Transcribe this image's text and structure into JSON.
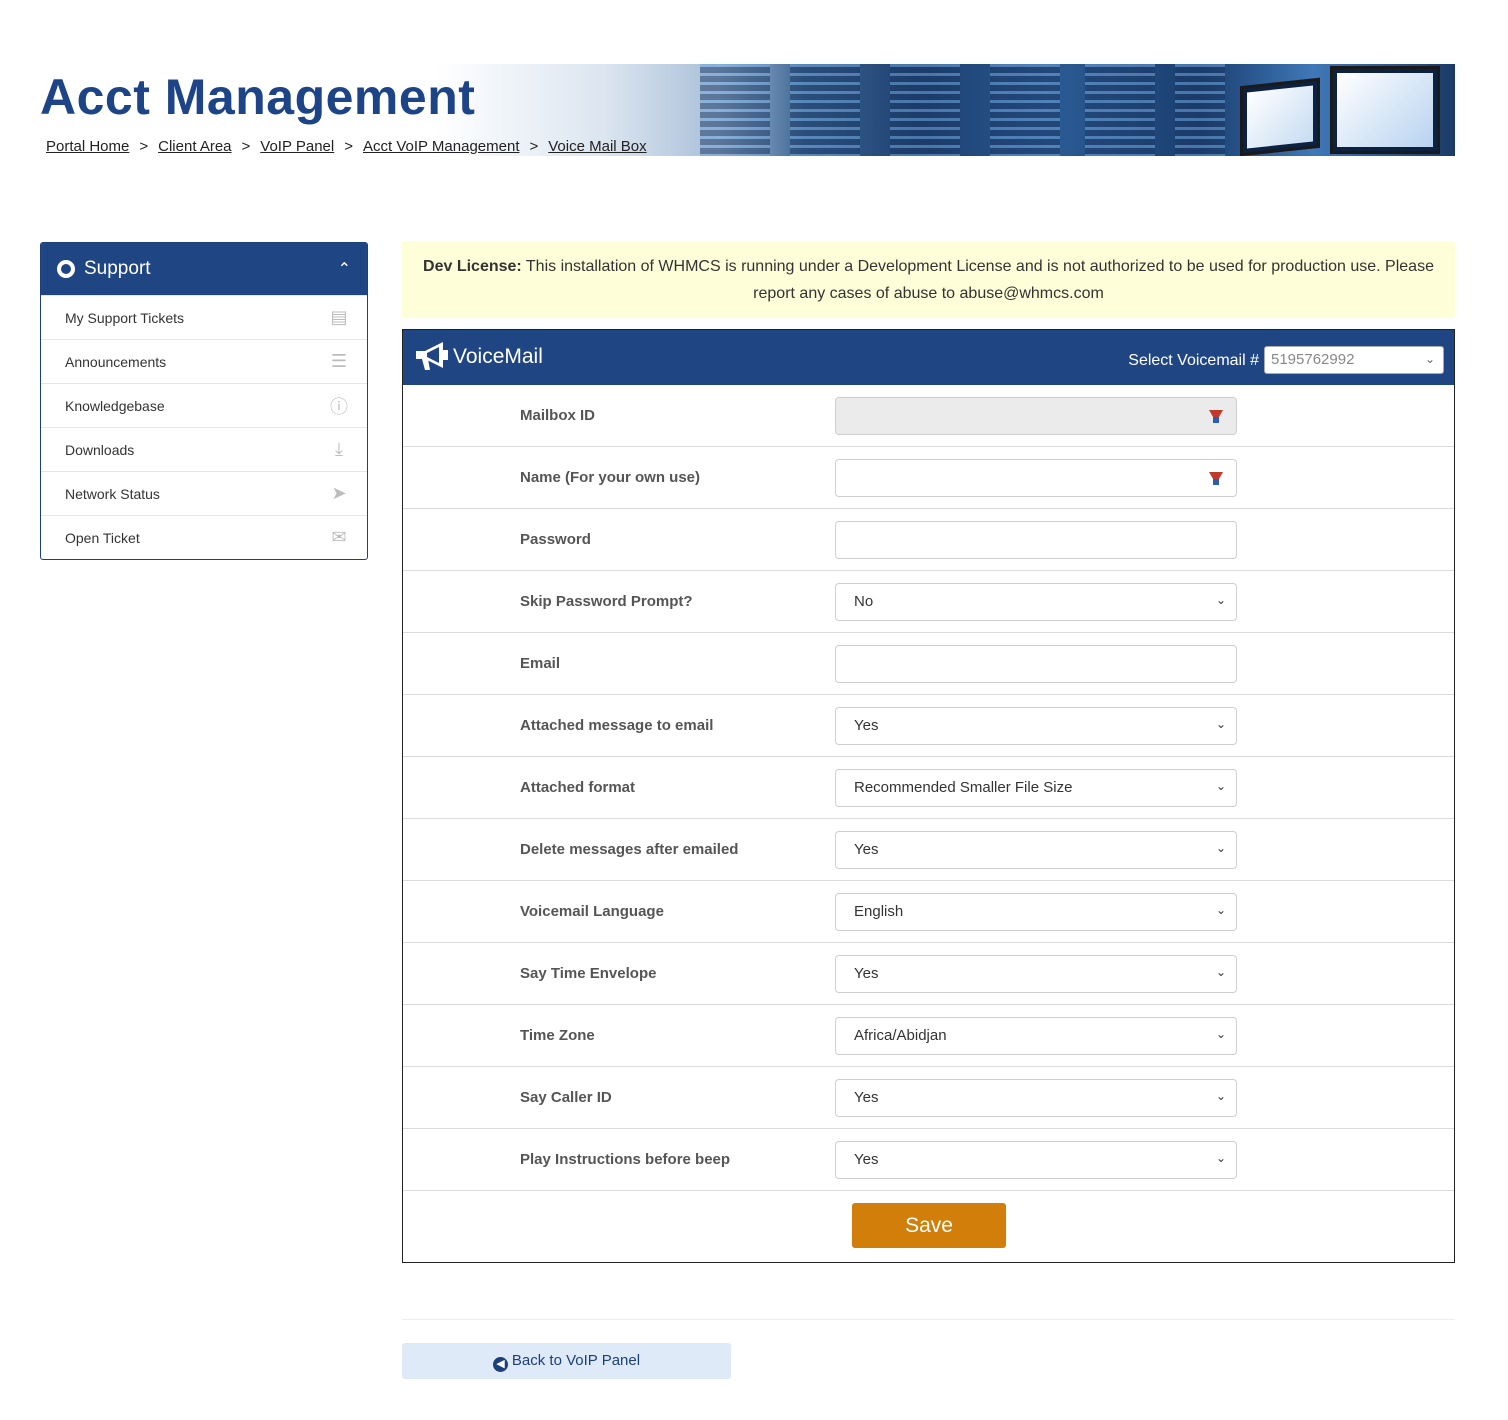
{
  "header": {
    "title": "Acct Management",
    "breadcrumb": [
      "Portal Home",
      "Client Area",
      "VoIP Panel",
      "Acct VoIP Management",
      "Voice Mail Box"
    ],
    "separator": ">"
  },
  "sidebar": {
    "title": "Support",
    "items": [
      {
        "label": "My Support Tickets",
        "icon": "ticket-icon"
      },
      {
        "label": "Announcements",
        "icon": "list-icon"
      },
      {
        "label": "Knowledgebase",
        "icon": "info-icon"
      },
      {
        "label": "Downloads",
        "icon": "download-icon"
      },
      {
        "label": "Network Status",
        "icon": "rocket-icon"
      },
      {
        "label": "Open Ticket",
        "icon": "comments-icon"
      }
    ]
  },
  "license": {
    "bold": "Dev License:",
    "text": "This installation of WHMCS is running under a Development License and is not authorized to be used for production use. Please report any cases of abuse to abuse@whmcs.com"
  },
  "voicemail": {
    "title": "VoiceMail",
    "select_label": "Select Voicemail #",
    "select_value": "5195762992",
    "rows": [
      {
        "label": "Mailbox ID",
        "value": ""
      },
      {
        "label": "Name (For your own use)",
        "value": ""
      },
      {
        "label": "Password",
        "value": ""
      },
      {
        "label": "Skip Password Prompt?",
        "value": "No"
      },
      {
        "label": "Email",
        "value": ""
      },
      {
        "label": "Attached message to email",
        "value": "Yes"
      },
      {
        "label": "Attached format",
        "value": "Recommended Smaller File Size"
      },
      {
        "label": "Delete messages after emailed",
        "value": "Yes"
      },
      {
        "label": "Voicemail Language",
        "value": "English"
      },
      {
        "label": "Say Time Envelope",
        "value": "Yes"
      },
      {
        "label": "Time Zone",
        "value": "Africa/Abidjan"
      },
      {
        "label": "Say Caller ID",
        "value": "Yes"
      },
      {
        "label": "Play Instructions before beep",
        "value": "Yes"
      }
    ],
    "save_label": "Save"
  },
  "back_label": "Back to VoIP Panel",
  "colors": {
    "brand": "#1f4583",
    "accent": "#d17e0a",
    "license_bg": "#fefed8"
  }
}
